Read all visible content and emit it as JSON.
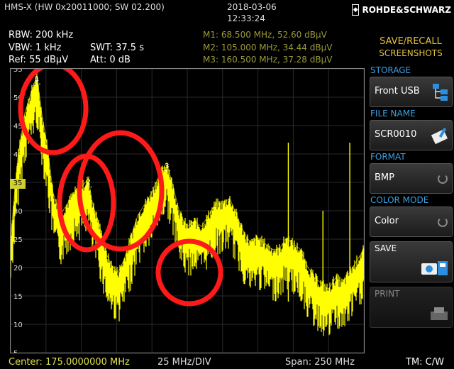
{
  "header": {
    "title": "HMS-X (HW 0x20011000; SW 02.200)",
    "date": "2018-03-06",
    "time": "12:33:24",
    "logo": "ROHDE&SCHWARZ"
  },
  "params": {
    "rbw": "RBW: 200 kHz",
    "vbw": "VBW: 1 kHz",
    "ref": "Ref: 55 dBµV",
    "swt": "SWT: 37.5 s",
    "att": "Att: 0 dB"
  },
  "markers": [
    {
      "text": "M1: 68.500 MHz, 52.60 dBµV",
      "freq_mhz": 68.5,
      "level": 52.6,
      "label": "1"
    },
    {
      "text": "M2: 105.000 MHz, 34.44 dBµV",
      "freq_mhz": 105.0,
      "level": 34.44,
      "label": "2"
    },
    {
      "text": "M3: 160.500 MHz, 37.28 dBµV",
      "freq_mhz": 160.5,
      "level": 37.28,
      "label": "3"
    }
  ],
  "ref_marker_label": "35",
  "footer": {
    "center": "Center: 175.0000000 MHz",
    "div": "25 MHz/DIV",
    "span": "Span: 250 MHz",
    "tm": "TM: C/W"
  },
  "panel": {
    "title_line1": "SAVE/RECALL",
    "title_line2": "SCREENSHOTS",
    "storage_label": "STORAGE",
    "storage_value": "Front USB",
    "filename_label": "FILE NAME",
    "filename_value": "SCR0010",
    "format_label": "FORMAT",
    "format_value": "BMP",
    "colormode_label": "COLOR MODE",
    "colormode_value": "Color",
    "save_label": "SAVE",
    "print_label": "PRINT"
  },
  "colors": {
    "trace": "#ffff00",
    "annotation": "#ff1a1a",
    "marker_text": "#9a9a3a",
    "panel_title": "#e0c040",
    "section_label": "#3ea0e0"
  },
  "chart_data": {
    "type": "line",
    "xlabel": "",
    "ylabel": "",
    "xlim": [
      50,
      300
    ],
    "ylim": [
      5,
      55
    ],
    "y_ticks": [
      5,
      10,
      15,
      20,
      25,
      30,
      35,
      40,
      45,
      50,
      55
    ],
    "series": [
      {
        "x": [
          50,
          55,
          60,
          65,
          68.5,
          72,
          76,
          80,
          85,
          90,
          95,
          100,
          105,
          108,
          112,
          115,
          118,
          122,
          126,
          130,
          135,
          140,
          145,
          150,
          155,
          160.5,
          165,
          170,
          175,
          180,
          185,
          190,
          195,
          200,
          205,
          210,
          215,
          220,
          225,
          230,
          235,
          240,
          245,
          250,
          255,
          260,
          265,
          270,
          275,
          280,
          285,
          290,
          295,
          300
        ],
        "values": [
          24,
          38,
          46,
          50,
          52.6,
          46,
          40,
          32,
          28,
          30,
          32,
          33,
          34.4,
          30,
          27,
          24,
          21,
          19,
          18,
          20,
          24,
          28,
          30,
          32,
          35,
          37.3,
          33,
          28,
          26,
          27,
          26,
          28,
          30,
          30,
          31,
          28,
          25,
          23,
          24,
          23,
          22,
          22,
          24,
          23,
          22,
          19,
          17,
          16,
          15,
          17,
          16,
          18,
          20,
          22
        ]
      }
    ],
    "grid": true
  }
}
